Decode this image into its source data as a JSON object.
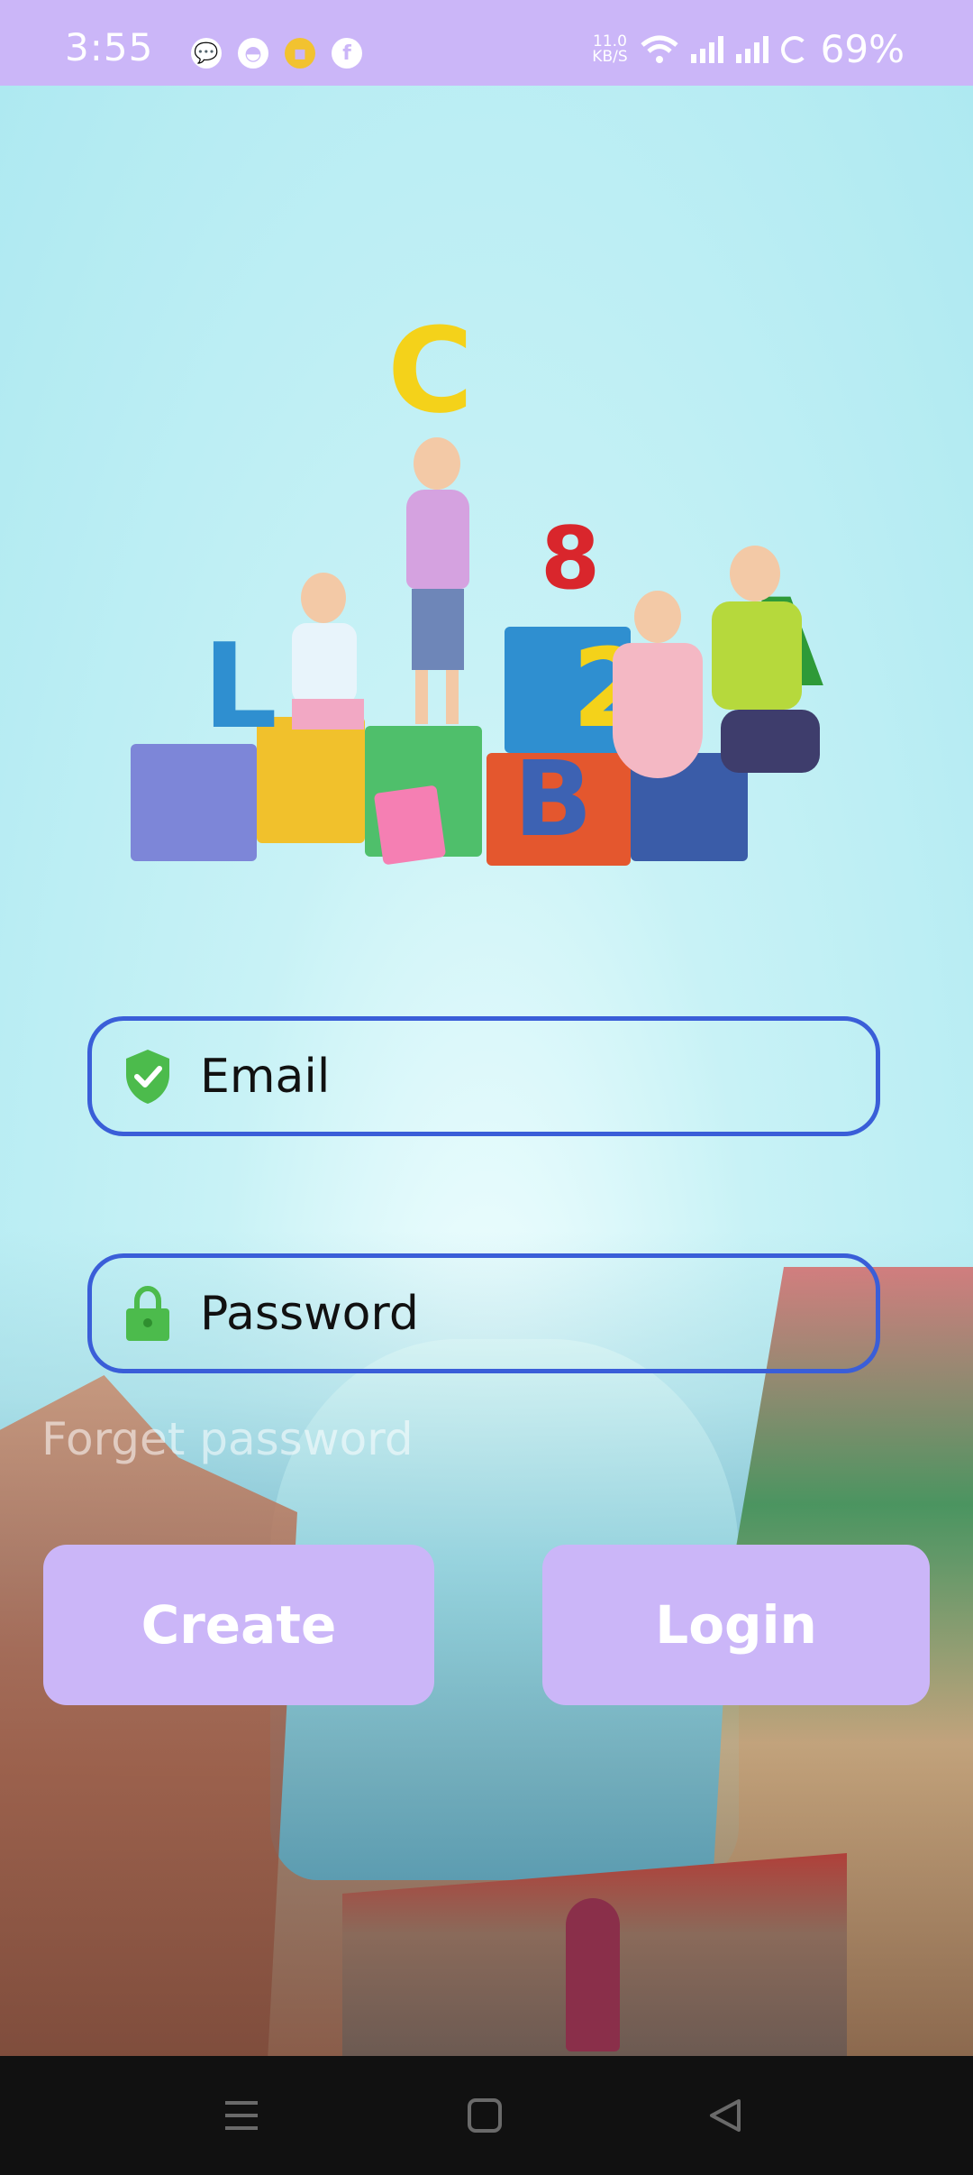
{
  "status_bar": {
    "time": "3:55",
    "net_speed_value": "11.0",
    "net_speed_unit": "KB/S",
    "battery": "69%",
    "icons": [
      "chat-icon",
      "app-icon",
      "notification-icon",
      "facebook-icon",
      "wifi-icon",
      "signal-icon",
      "signal-icon",
      "battery-ring-icon"
    ]
  },
  "illustration": {
    "letters": [
      "C",
      "8",
      "2",
      "A",
      "B",
      "L"
    ]
  },
  "form": {
    "email_placeholder": "Email",
    "password_placeholder": "Password",
    "forgot_label": "Forget password"
  },
  "buttons": {
    "create_label": "Create",
    "login_label": "Login"
  },
  "colors": {
    "accent": "#cbb6f8",
    "field_border": "#3a5ed8",
    "icon_green": "#4cbb4c"
  }
}
